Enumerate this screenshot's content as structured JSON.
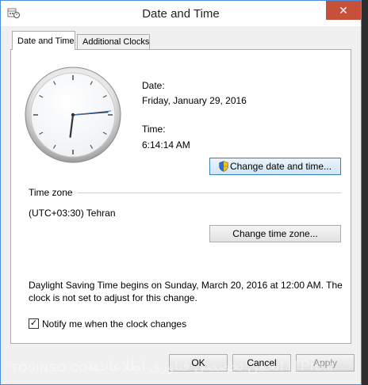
{
  "window": {
    "title": "Date and Time",
    "close_glyph": "✕"
  },
  "tabs": [
    {
      "label": "Date and Time",
      "active": true
    },
    {
      "label": "Additional Clocks",
      "active": false
    }
  ],
  "datetime": {
    "date_label": "Date:",
    "date_value": "Friday, January 29, 2016",
    "time_label": "Time:",
    "time_value": "6:14:14 AM",
    "change_button": "Change date and time..."
  },
  "timezone": {
    "section_label": "Time zone",
    "value": "(UTC+03:30) Tehran",
    "change_button": "Change time zone..."
  },
  "dst": {
    "message": "Daylight Saving Time begins on Sunday, March 20, 2016 at 12:00 AM. The clock is not set to adjust for this change."
  },
  "notify": {
    "label": "Notify me when the clock changes",
    "checked": true,
    "check_glyph": "✓"
  },
  "footer": {
    "ok": "OK",
    "cancel": "Cancel",
    "apply": "Apply"
  },
  "watermark": {
    "left": "TOSINSO.COM",
    "right": "انجمن تخصصی فناوری اطلاعات ITPro.ir"
  },
  "clock": {
    "hour": 6,
    "minute": 14,
    "second": 14
  },
  "colors": {
    "accent": "#4a8fd8",
    "close": "#c7503b",
    "second_hand": "#3d7bbf"
  }
}
